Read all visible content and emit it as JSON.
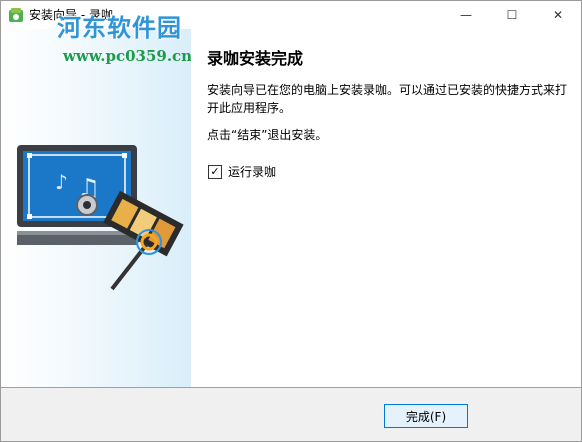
{
  "window": {
    "title": "安装向导 - 录咖",
    "watermark_text": "河东软件园",
    "watermark_url": "www.pc0359.cn",
    "controls": {
      "minimize": "—",
      "maximize": "☐",
      "close": "✕"
    }
  },
  "main": {
    "heading": "录咖安装完成",
    "description": "安装向导已在您的电脑上安装录咖。可以通过已安装的快捷方式来打开此应用程序。",
    "hint": "点击“结束”退出安装。",
    "run_checkbox": {
      "label": "运行录咖",
      "checked": true,
      "mark": "✓"
    }
  },
  "footer": {
    "finish_label": "完成(F)"
  },
  "colors": {
    "accent": "#0078d7",
    "watermark_blue": "#2f95d8",
    "watermark_green": "#1f9a4a"
  }
}
